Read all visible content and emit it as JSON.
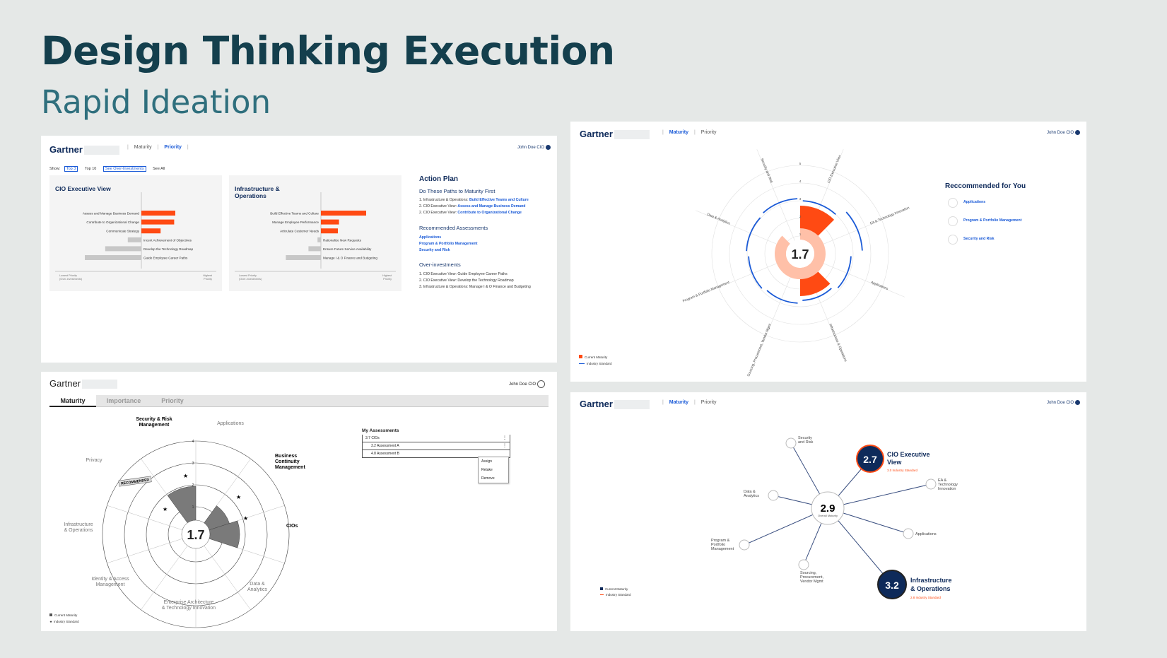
{
  "page": {
    "title": "Design Thinking Execution",
    "subtitle": "Rapid Ideation"
  },
  "brand": {
    "logo": "Gartner",
    "user": "John Doe CIO",
    "user_alt": "John Doe CIO"
  },
  "nav": {
    "maturity": "Maturity",
    "priority": "Priority",
    "importance": "Importance"
  },
  "panel1": {
    "show_label": "Show:",
    "filters": [
      "Top 3",
      "Top 10",
      "See Over-Investments",
      "See All"
    ],
    "card1": {
      "title": "CIO Executive View",
      "bars": [
        {
          "label": "Assess and Manage Business Demand",
          "value": 3
        },
        {
          "label": "Contribute to Organizational Change",
          "value": 2.9
        },
        {
          "label": "Communicate Strategy",
          "value": 1.7
        },
        {
          "label": "Incent Achievement of Objectives",
          "value": -1.2
        },
        {
          "label": "Develop the Technology Roadmap",
          "value": -3.2
        },
        {
          "label": "Guide Employee Career Paths",
          "value": -5
        }
      ],
      "axis_left": "Lowest Priority",
      "axis_left2": "(Over-investments)",
      "axis_right": "Highest",
      "axis_right2": "Priority"
    },
    "card2": {
      "title": "Infrastructure &",
      "title2": "Operations",
      "bars": [
        {
          "label": "Build Effective Teams and Culture",
          "value": 4
        },
        {
          "label": "Manage Employee Performance",
          "value": 1.6
        },
        {
          "label": "Articulate Customer Needs",
          "value": 1.5
        },
        {
          "label": "Rationalize New Requests",
          "value": -0.3
        },
        {
          "label": "Ensure Future Service Availability",
          "value": -1.1
        },
        {
          "label": "Manage I & O Finance and Budgeting",
          "value": -3.1
        }
      ],
      "axis_left": "Lowest Priority",
      "axis_left2": "(Over-investments)",
      "axis_right": "Highest",
      "axis_right2": "Priority"
    },
    "action_plan": {
      "title": "Action Plan",
      "first_heading": "Do These Paths to Maturity First",
      "first_items": [
        {
          "prefix": "1. Infrastructure & Operations:",
          "link": "Build Effective Teams and Culture"
        },
        {
          "prefix": "2. CIO Executive View:",
          "link": "Assess and Manage Business Demand"
        },
        {
          "prefix": "2. CIO Executive View:",
          "link": "Contribute to Organizational Change"
        }
      ],
      "assess_heading": "Recommended Assessments",
      "assess_items": [
        "Applications",
        "Program & Portfolio Management",
        "Security and Risk"
      ],
      "over_heading": "Over-investments",
      "over_items": [
        "1. CIO Executive View: Guide Employee Career Paths",
        "2. CIO Executive View: Develop the Technology Roadmap",
        "3. Infrastructure & Operations: Manage I & O Finance and Budgeting"
      ]
    }
  },
  "panel2": {
    "center_value": "1.7",
    "ticks": [
      "1",
      "2",
      "3",
      "4",
      "5"
    ],
    "axes": [
      "CIO Executive View",
      "EA & Technology Innovation",
      "Applications",
      "Infrastructure & Operations",
      "Sourcing, Procurement, Vendor Mgmt",
      "Program & Portfolio Management",
      "Data & Analytics",
      "Security and Risk"
    ],
    "recommended_title": "Reccommended for You",
    "recommended": [
      "Applications",
      "Program & Portfolio Management",
      "Security and Risk"
    ],
    "legend": [
      "Current Maturity",
      "Industry Standard"
    ],
    "colors": {
      "accent": "#ff4a13",
      "standard": "#1a5ad7"
    }
  },
  "panel3": {
    "center_value": "1.7",
    "ticks": [
      "1",
      "2",
      "3",
      "4"
    ],
    "labels": {
      "security": "Security & Risk",
      "security2": "Management",
      "applications": "Applications",
      "business": "Business",
      "business2": "Continuity",
      "business3": "Management",
      "cios": "CIOs",
      "data": "Data &",
      "data2": "Analytics",
      "ea": "Enterprise Architecture",
      "ea2": "& Technology Innovation",
      "identity": "Identity & Access",
      "identity2": "Management",
      "infra": "Infrastructure",
      "infra2": "& Operations",
      "privacy": "Privacy"
    },
    "recommended_badge": "RECOMMENDED",
    "assessments": {
      "title": "My Assessments",
      "rows": [
        "3.7 CIOs",
        "3.2 Assessment A",
        "4.8 Assessment B"
      ],
      "menu": [
        "Assign",
        "Retake",
        "Remove"
      ]
    },
    "legend": [
      "Current Maturity",
      "Industry Standard"
    ]
  },
  "panel4": {
    "center_value": "2.9",
    "center_label": "Overall Maturity",
    "nodes": [
      {
        "label": "Security",
        "label2": "and Risk"
      },
      {
        "label": "EA &",
        "label2": "Technology",
        "label3": "Innovation"
      },
      {
        "label": "Applications"
      },
      {
        "label": "Sourcing,",
        "label2": "Procurement,",
        "label3": "Vendor Mgmt"
      },
      {
        "label": "Program &",
        "label2": "Portfolio",
        "label3": "Management"
      },
      {
        "label": "Data &",
        "label2": "Analytics"
      }
    ],
    "cio": {
      "value": "2.7",
      "title": "CIO Executive",
      "title2": "View",
      "standard": "3.0 Industry Standard"
    },
    "infra": {
      "value": "3.2",
      "title": "Infrastructure",
      "title2": "& Operations",
      "standard": "2.8 Industry Standard"
    },
    "legend": [
      "Current Maturity",
      "Industry Standard"
    ]
  }
}
